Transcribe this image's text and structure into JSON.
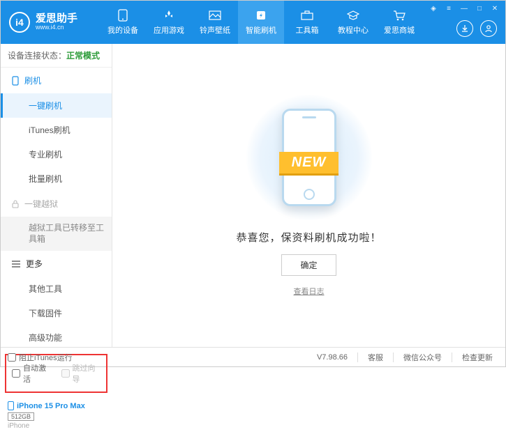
{
  "header": {
    "logo_title": "爱思助手",
    "logo_sub": "www.i4.cn",
    "nav": [
      {
        "label": "我的设备"
      },
      {
        "label": "应用游戏"
      },
      {
        "label": "铃声壁纸"
      },
      {
        "label": "智能刷机"
      },
      {
        "label": "工具箱"
      },
      {
        "label": "教程中心"
      },
      {
        "label": "爱思商城"
      }
    ]
  },
  "sidebar": {
    "status_label": "设备连接状态：",
    "status_value": "正常模式",
    "section_flash": "刷机",
    "items_flash": [
      "一键刷机",
      "iTunes刷机",
      "专业刷机",
      "批量刷机"
    ],
    "section_jailbreak": "一键越狱",
    "jailbreak_note": "越狱工具已转移至工具箱",
    "section_more": "更多",
    "items_more": [
      "其他工具",
      "下载固件",
      "高级功能"
    ],
    "checkbox1": "自动激活",
    "checkbox2": "跳过向导",
    "device_name": "iPhone 15 Pro Max",
    "device_storage": "512GB",
    "device_type": "iPhone"
  },
  "main": {
    "ribbon": "NEW",
    "success": "恭喜您，保资料刷机成功啦！",
    "confirm": "确定",
    "log_link": "查看日志"
  },
  "footer": {
    "block_itunes": "阻止iTunes运行",
    "version": "V7.98.66",
    "items": [
      "客服",
      "微信公众号",
      "检查更新"
    ]
  }
}
